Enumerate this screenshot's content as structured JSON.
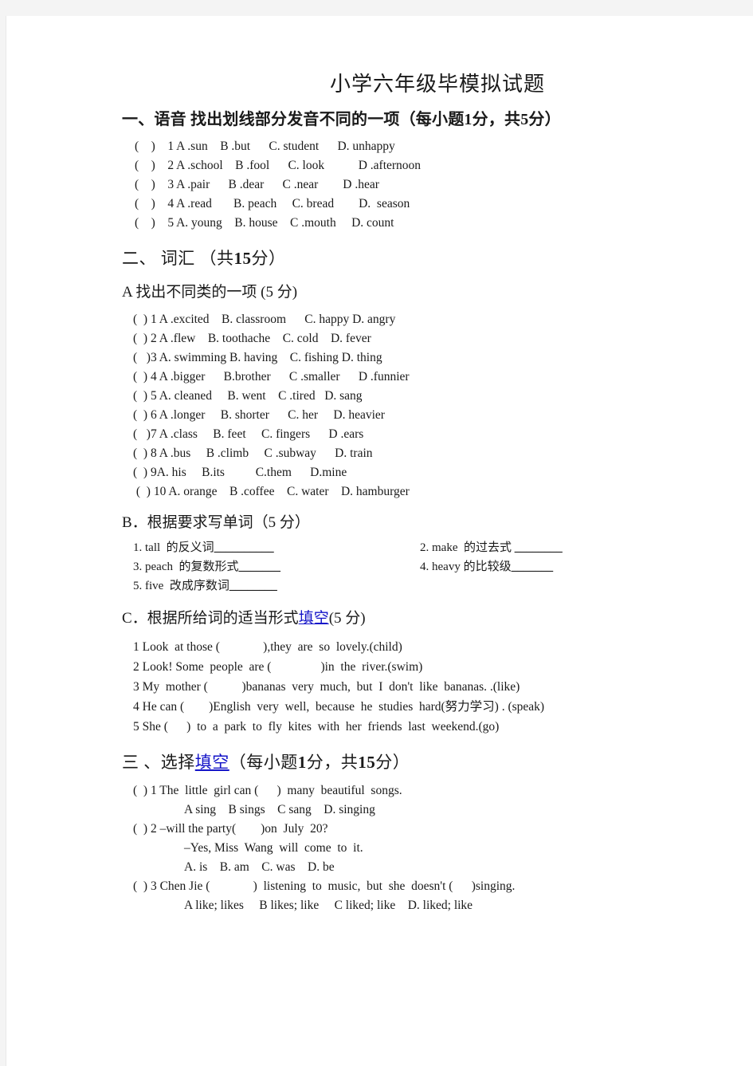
{
  "document": {
    "title": "小学六年级毕模拟试题"
  },
  "section1": {
    "header_prefix": "一、语音 找出划线部分发音不同的一项（每小题",
    "header_score1": "1",
    "header_mid": "分，共",
    "header_score2": "5",
    "header_suffix": "分）",
    "items": [
      "(    )    1 A .sun    B .but      C. student      D. unhappy",
      "(    )    2 A .school    B .fool      C. look           D .afternoon",
      "(    )    3 A .pair      B .dear      C .near        D .hear",
      "(    )    4 A .read       B. peach     C. bread        D.  season",
      "(    )    5 A. young    B. house    C .mouth     D. count"
    ]
  },
  "section2": {
    "header": "二、   词汇  （共",
    "header_score": "15",
    "header_suffix": "分）",
    "partA": {
      "header": "A  找出不同类的一项 (5 分)",
      "items": [
        "(  ) 1 A .excited    B. classroom      C. happy D. angry",
        "(  ) 2 A .flew    B. toothache    C. cold    D. fever",
        "(   )3 A. swimming B. having    C. fishing D. thing",
        "(  ) 4 A .bigger      B.brother      C .smaller      D .funnier",
        "(  ) 5 A. cleaned     B. went    C .tired   D. sang",
        "(  ) 6 A .longer     B. shorter      C. her     D. heavier",
        "(   )7 A .class     B. feet     C. fingers      D .ears",
        "(  ) 8 A .bus     B .climb     C .subway      D. train",
        "(  ) 9A. his     B.its          C.them      D.mine",
        " (  ) 10 A. orange    B .coffee    C. water    D. hamburger"
      ]
    },
    "partB": {
      "header": "B．根据要求写单词（5 分）",
      "rows": [
        {
          "left": "1. tall  的反义词",
          "left_blank": "__________",
          "right": "2. make  的过去式 ",
          "right_blank": "________"
        },
        {
          "left": "3. peach  的复数形式",
          "left_blank": "_______",
          "right": "4. heavy 的比较级",
          "right_blank": "_______"
        },
        {
          "left": "5. five  改成序数词",
          "left_blank": "________",
          "right": "",
          "right_blank": ""
        }
      ]
    },
    "partC": {
      "header_pre": "C．根据所给词的适当形式",
      "header_link": "填空",
      "header_post": "(5 分)",
      "items": [
        "1 Look  at those (              ),they  are  so  lovely.(child)",
        "2 Look! Some  people  are (                )in  the  river.(swim)",
        "3 My  mother (           )bananas  very  much,  but  I  don't  like  bananas. .(like)",
        "4 He can (        )English  very  well,  because  he  studies  hard(努力学习) . (speak)",
        "5 She (      )  to  a  park  to  fly  kites  with  her  friends  last  weekend.(go)"
      ]
    }
  },
  "section3": {
    "header_pre": "三 、选择",
    "header_link": "填空",
    "header_mid1": "（每小题",
    "header_score1": "1",
    "header_mid2": "分，共",
    "header_score2": "15",
    "header_suffix": "分）",
    "items": [
      {
        "stem": "(  ) 1 The  little  girl can (      )  many  beautiful  songs.",
        "options": "A sing    B sings    C sang    D. singing"
      },
      {
        "stem": "(  ) 2 –will the party(        )on  July  20?",
        "line2": "–Yes, Miss  Wang  will  come  to  it.",
        "options": "A. is    B. am    C. was    D. be"
      },
      {
        "stem": "(  ) 3 Chen Jie (              )  listening  to  music,  but  she  doesn't (      )singing.",
        "options": "A like; likes     B likes; like     C liked; like    D. liked; like"
      }
    ]
  }
}
